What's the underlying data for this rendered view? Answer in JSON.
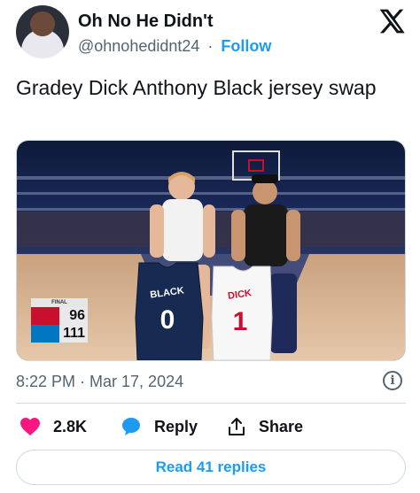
{
  "author": {
    "display_name": "Oh No He Didn't",
    "handle": "@ohnohedidnt24",
    "separator": "·",
    "follow_label": "Follow"
  },
  "tweet": {
    "text": "Gradey Dick Anthony Black jersey swap",
    "timestamp": "8:22 PM · Mar 17, 2024"
  },
  "photo": {
    "scoreboard": {
      "status": "FINAL",
      "home_score": "96",
      "away_score": "111"
    },
    "left_jersey": {
      "name": "BLACK",
      "number": "0"
    },
    "right_jersey": {
      "name": "DICK",
      "number": "1"
    }
  },
  "actions": {
    "like_count": "2.8K",
    "reply_label": "Reply",
    "share_label": "Share"
  },
  "read_replies_label": "Read 41 replies",
  "colors": {
    "accent": "#1d9bf0",
    "like": "#f91880",
    "muted": "#536471"
  },
  "icons": [
    "x-logo-icon",
    "heart-icon",
    "reply-bubble-icon",
    "share-icon",
    "info-icon"
  ]
}
